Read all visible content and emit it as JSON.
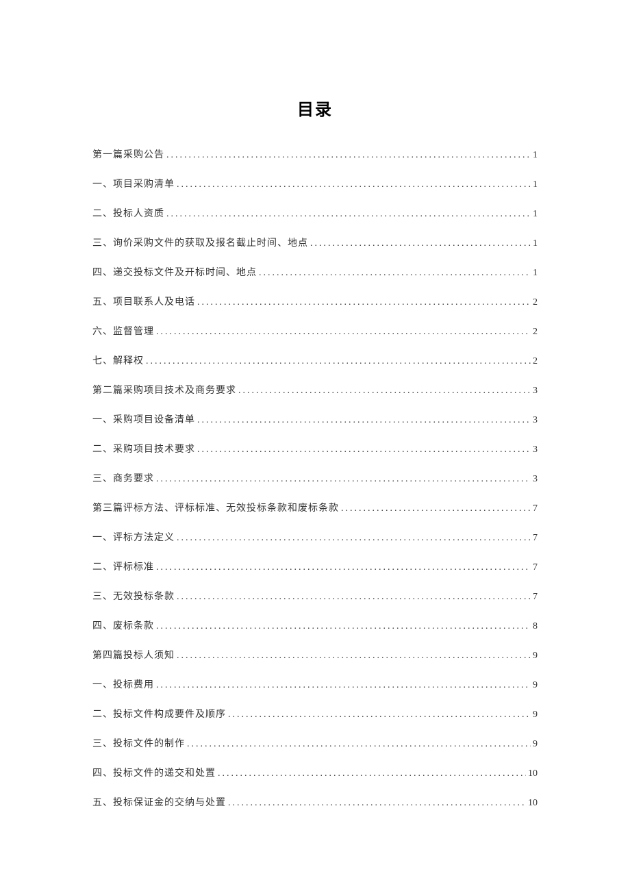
{
  "title": "目录",
  "toc": [
    {
      "label": "第一篇采购公告",
      "page": "1"
    },
    {
      "label": "一、项目采购清单",
      "page": "1"
    },
    {
      "label": "二、投标人资质",
      "page": "1"
    },
    {
      "label": "三、询价采购文件的获取及报名截止时间、地点",
      "page": "1"
    },
    {
      "label": "四、递交投标文件及开标时间、地点",
      "page": "1"
    },
    {
      "label": "五、项目联系人及电话",
      "page": "2"
    },
    {
      "label": "六、监督管理",
      "page": "2"
    },
    {
      "label": "七、解释权",
      "page": "2"
    },
    {
      "label": "第二篇采购项目技术及商务要求",
      "page": "3"
    },
    {
      "label": "一、采购项目设备清单",
      "page": "3"
    },
    {
      "label": "二、采购项目技术要求",
      "page": "3"
    },
    {
      "label": "三、商务要求",
      "page": "3"
    },
    {
      "label": "第三篇评标方法、评标标准、无效投标条款和废标条款",
      "page": "7"
    },
    {
      "label": "一、评标方法定义",
      "page": "7"
    },
    {
      "label": "二、评标标准",
      "page": "7"
    },
    {
      "label": "三、无效投标条款",
      "page": "7"
    },
    {
      "label": "四、废标条款",
      "page": "8"
    },
    {
      "label": "第四篇投标人须知",
      "page": "9"
    },
    {
      "label": "一、投标费用",
      "page": "9"
    },
    {
      "label": "二、投标文件构成要件及顺序",
      "page": "9"
    },
    {
      "label": "三、投标文件的制作",
      "page": "9"
    },
    {
      "label": "四、投标文件的递交和处置",
      "page": "10"
    },
    {
      "label": "五、投标保证金的交纳与处置",
      "page": "10"
    }
  ]
}
